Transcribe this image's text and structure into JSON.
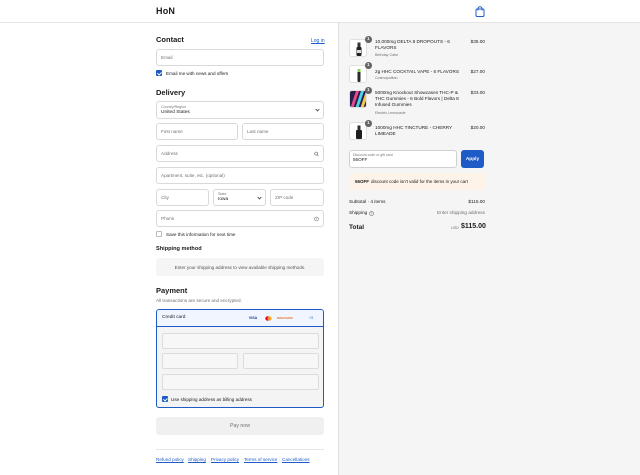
{
  "header": {
    "logo": "HoN",
    "cart_icon": "shopping-bag-icon"
  },
  "contact": {
    "title": "Contact",
    "login_link": "Log in",
    "email_placeholder": "Email",
    "newsletter_label": "Email me with news and offers",
    "newsletter_checked": true
  },
  "delivery": {
    "title": "Delivery",
    "country_label": "Country/Region",
    "country_value": "United States",
    "first_name_placeholder": "First name",
    "last_name_placeholder": "Last name",
    "address_placeholder": "Address",
    "apartment_placeholder": "Apartment, suite, etc. (optional)",
    "city_placeholder": "City",
    "state_label": "State",
    "state_value": "Iowa",
    "zip_placeholder": "ZIP code",
    "phone_placeholder": "Phone",
    "save_info_label": "Save this information for next time",
    "save_info_checked": false
  },
  "shipping": {
    "title": "Shipping method",
    "note": "Enter your shipping address to view available shipping methods."
  },
  "payment": {
    "title": "Payment",
    "subtitle": "All transactions are secure and encrypted.",
    "method_label": "Credit card",
    "card_logos": [
      "VISA",
      "mastercard",
      "DISCOVER",
      "+3"
    ],
    "billing_same_label": "Use shipping address as billing address",
    "billing_same_checked": true,
    "pay_button": "Pay now"
  },
  "footer": {
    "links": [
      "Refund policy",
      "Shipping",
      "Privacy policy",
      "Terms of service",
      "Cancellations"
    ]
  },
  "order": {
    "items": [
      {
        "qty": "1",
        "name": "10,000mg DELTA 8 DROPOUTS - 6 FLAVORS",
        "variant": "Birthday Cake",
        "price": "$35.00"
      },
      {
        "qty": "1",
        "name": "2g HHC COCKTAIL VAPE - 6 FLAVORS",
        "variant": "Cosmopolitan",
        "price": "$27.00"
      },
      {
        "qty": "1",
        "name": "5000mg Knockout Showcases THC-P & THC Gummies - 6 Bold Flavors | Delta 8 Infused Gummies",
        "variant": "Electric Lemonade",
        "price": "$33.00"
      },
      {
        "qty": "1",
        "name": "1000mg HHC TINCTURE - CHERRY LIMEADE",
        "variant": "",
        "price": "$20.00"
      }
    ],
    "discount_label": "Discount code or gift card",
    "discount_value": "56OFF",
    "apply_button": "Apply",
    "warning_code": "56OFF",
    "warning_text": "discount code isn't valid for the items in your cart",
    "subtotal_label": "Subtotal · 4 items",
    "subtotal_value": "$115.00",
    "shipping_label": "Shipping",
    "shipping_value": "Enter shipping address",
    "total_label": "Total",
    "total_currency": "USD",
    "total_value": "$115.00"
  },
  "colors": {
    "accent": "#1f5bc6",
    "summary_bg": "#f5f5f5",
    "warning_bg": "#fdf3e8"
  }
}
